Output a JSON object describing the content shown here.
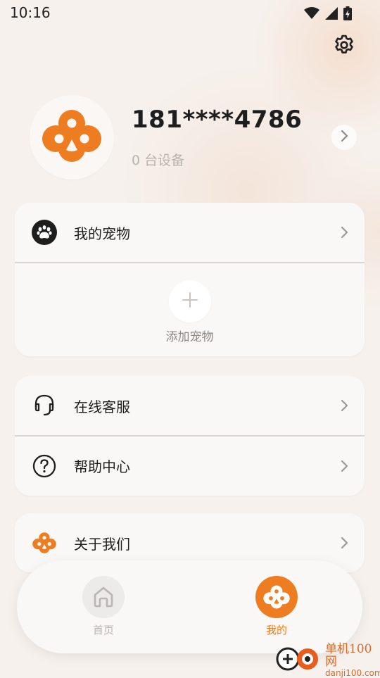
{
  "status_bar": {
    "time": "10:16"
  },
  "profile": {
    "phone": "181****4786",
    "device_count": "0 台设备"
  },
  "pets_card": {
    "title": "我的宠物",
    "add_label": "添加宠物"
  },
  "service_card": {
    "items": [
      {
        "label": "在线客服",
        "icon": "headset-icon"
      },
      {
        "label": "帮助中心",
        "icon": "question-circle-icon"
      }
    ]
  },
  "about_card": {
    "label": "关于我们",
    "icon": "brand-logo-icon"
  },
  "tabbar": {
    "tabs": [
      {
        "label": "首页",
        "icon": "home-icon",
        "active": false
      },
      {
        "label": "我的",
        "icon": "brand-logo-icon",
        "active": true
      }
    ]
  },
  "watermark": {
    "title": "单机100网",
    "url": "danji100.com"
  },
  "colors": {
    "accent": "#ee7d22",
    "background": "#f6f1ed",
    "card": "#faf8f6",
    "text": "#1e1e1e",
    "muted": "#b8b2ad"
  }
}
